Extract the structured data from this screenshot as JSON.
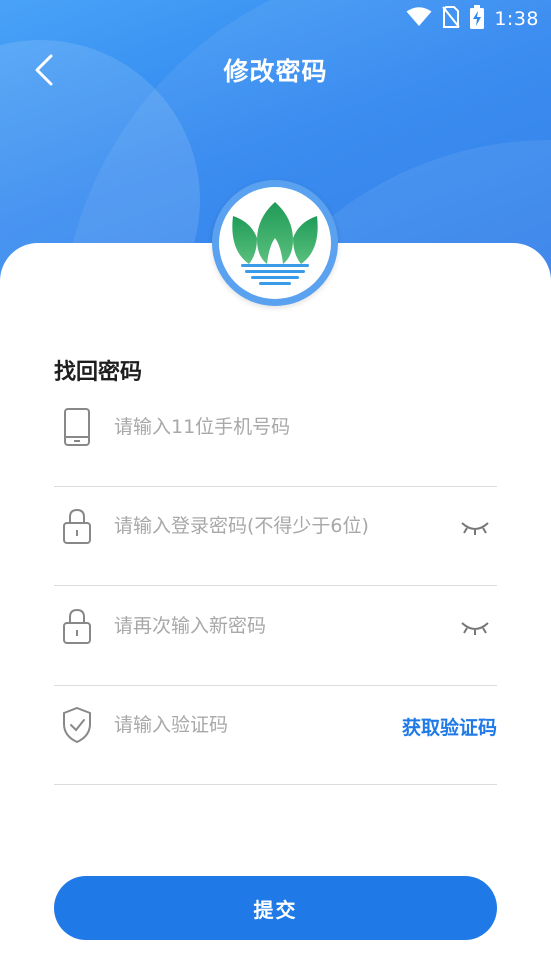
{
  "status_bar": {
    "time": "1:38",
    "icons": [
      "wifi-icon",
      "no-sim-icon",
      "battery-charging-icon"
    ]
  },
  "header": {
    "title": "修改密码",
    "back_icon": "chevron-left-icon"
  },
  "form": {
    "section_title": "找回密码",
    "phone": {
      "placeholder": "请输入11位手机号码",
      "value": "",
      "icon": "phone-icon"
    },
    "password": {
      "placeholder": "请输入登录密码(不得少于6位)",
      "value": "",
      "icon": "lock-icon",
      "toggle_icon": "eye-closed-icon"
    },
    "confirm_password": {
      "placeholder": "请再次输入新密码",
      "value": "",
      "icon": "lock-icon",
      "toggle_icon": "eye-closed-icon"
    },
    "code": {
      "placeholder": "请输入验证码",
      "value": "",
      "icon": "shield-check-icon",
      "get_code_label": "获取验证码"
    },
    "submit_label": "提交"
  },
  "colors": {
    "primary": "#1f7ae8",
    "header_gradient_start": "#4aa3f7",
    "header_gradient_end": "#1f74e8",
    "placeholder": "#a8a8a8",
    "divider": "#dcdcdc"
  }
}
